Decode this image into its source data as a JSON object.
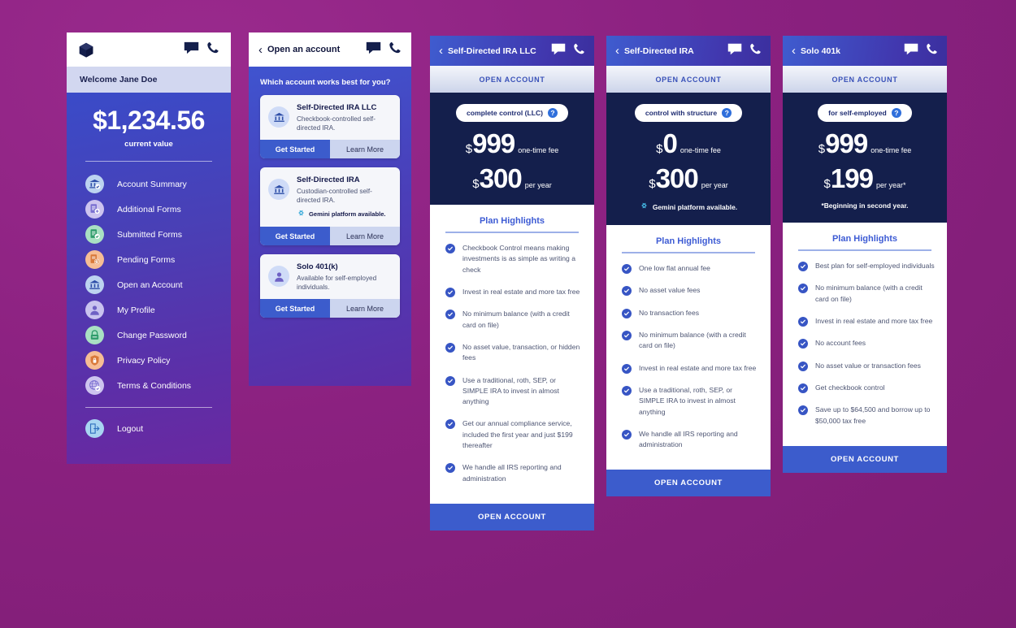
{
  "theme": {
    "background": "#8b2180",
    "accent_blue": "#3c5ccc",
    "dark_navy": "#141f4c",
    "highlight_title": "#3d5bd4"
  },
  "dashboard": {
    "brand_icon": "cube-logo-icon",
    "chat_icon": "chat-icon",
    "phone_icon": "phone-icon",
    "welcome": "Welcome Jane Doe",
    "balance": "$1,234.56",
    "balance_label": "current value",
    "nav": [
      {
        "label": "Account Summary",
        "icon": "bank-check-icon",
        "color": "#bcd3f0"
      },
      {
        "label": "Additional Forms",
        "icon": "form-plus-icon",
        "color": "#cdc4ef"
      },
      {
        "label": "Submitted Forms",
        "icon": "form-check-icon",
        "color": "#a9e0c3"
      },
      {
        "label": "Pending Forms",
        "icon": "form-clock-icon",
        "color": "#f6bd94"
      },
      {
        "label": "Open an Account",
        "icon": "bank-icon",
        "color": "#bcd3f0"
      },
      {
        "label": "My Profile",
        "icon": "person-icon",
        "color": "#c9c3ef"
      },
      {
        "label": "Change Password",
        "icon": "lock-icon",
        "color": "#a9e0c3"
      },
      {
        "label": "Privacy Policy",
        "icon": "shield-lock-icon",
        "color": "#f6bd94"
      },
      {
        "label": "Terms & Conditions",
        "icon": "globe-check-icon",
        "color": "#cdc4ef"
      }
    ],
    "logout": {
      "label": "Logout",
      "icon": "logout-icon",
      "color": "#a8d5f2"
    }
  },
  "open_account": {
    "title": "Open an account",
    "back_icon": "back-chevron-icon",
    "chat_icon": "chat-icon",
    "phone_icon": "phone-icon",
    "question": "Which account works best for you?",
    "btn_get_started": "Get Started",
    "btn_learn_more": "Learn More",
    "cards": [
      {
        "name": "Self-Directed IRA LLC",
        "desc": "Checkbook-controlled self-directed IRA.",
        "icon": "bank-icon",
        "gemini": ""
      },
      {
        "name": "Self-Directed IRA",
        "desc": "Custodian-controlled self-directed IRA.",
        "icon": "bank-icon",
        "gemini": "Gemini platform available."
      },
      {
        "name": "Solo 401(k)",
        "desc": "Available for self-employed individuals.",
        "icon": "person-icon",
        "gemini": ""
      }
    ]
  },
  "plans": [
    {
      "title": "Self-Directed IRA LLC",
      "open_account_top": "OPEN ACCOUNT",
      "open_account_bottom": "OPEN ACCOUNT",
      "badge": "complete control (LLC)",
      "badge_help": "?",
      "prices": [
        {
          "currency": "$",
          "amount": "999",
          "unit": "one-time fee"
        },
        {
          "currency": "$",
          "amount": "300",
          "unit": "per year"
        }
      ],
      "gemini": "",
      "note": "",
      "highlights_title": "Plan Highlights",
      "highlights": [
        "Checkbook Control means making investments is as simple as writing a check",
        "Invest in real estate and more tax free",
        "No minimum balance (with a credit card on file)",
        "No asset value, transaction, or hidden fees",
        "Use a traditional, roth, SEP, or SIMPLE IRA to invest in almost anything",
        "Get our annual compliance service, included the first year and just $199 thereafter",
        "We handle all IRS reporting and administration"
      ]
    },
    {
      "title": "Self-Directed IRA",
      "open_account_top": "OPEN ACCOUNT",
      "open_account_bottom": "OPEN ACCOUNT",
      "badge": "control with structure",
      "badge_help": "?",
      "prices": [
        {
          "currency": "$",
          "amount": "0",
          "unit": "one-time fee"
        },
        {
          "currency": "$",
          "amount": "300",
          "unit": "per year"
        }
      ],
      "gemini": "Gemini platform available.",
      "note": "",
      "highlights_title": "Plan Highlights",
      "highlights": [
        "One low flat annual fee",
        "No asset value fees",
        "No transaction fees",
        "No minimum balance (with a credit card on file)",
        "Invest in real estate and more tax free",
        "Use a traditional, roth, SEP, or SIMPLE IRA to invest in almost anything",
        "We handle all IRS reporting and administration"
      ]
    },
    {
      "title": "Solo 401k",
      "open_account_top": "OPEN ACCOUNT",
      "open_account_bottom": "OPEN ACCOUNT",
      "badge": "for self-employed",
      "badge_help": "?",
      "prices": [
        {
          "currency": "$",
          "amount": "999",
          "unit": "one-time fee"
        },
        {
          "currency": "$",
          "amount": "199",
          "unit": "per year*"
        }
      ],
      "gemini": "",
      "note": "*Beginning in second year.",
      "highlights_title": "Plan Highlights",
      "highlights": [
        "Best plan for self-employed individuals",
        "No minimum balance (with a credit card on file)",
        "Invest in real estate and more tax free",
        "No account fees",
        "No asset value or transaction fees",
        "Get checkbook control",
        "Save up to $64,500 and borrow up to $50,000 tax free"
      ]
    }
  ]
}
